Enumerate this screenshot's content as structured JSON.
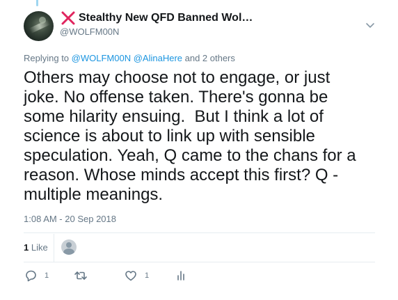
{
  "tweet": {
    "display_name": "Stealthy New QFD Banned Wol…",
    "handle": "@WOLFM00N",
    "reply_prefix": "Replying to ",
    "reply_handle_1": "@WOLFM00N",
    "reply_handle_2": "@AlinaHere",
    "reply_suffix": " and 2 others",
    "text": "Others may choose not to engage, or just\njoke. No offense taken. There's gonna be\nsome hilarity ensuing.  But I think a lot of\nscience is about to link up with sensible\nspeculation. Yeah, Q came to the chans for a\nreason. Whose minds accept this first? Q -\nmultiple meanings.",
    "timestamp": "1:08 AM - 20 Sep 2018"
  },
  "stats": {
    "like_count": "1",
    "like_label": "Like"
  },
  "actions": {
    "reply_count": "1",
    "retweet_count": "",
    "like_count": "1"
  },
  "icons": {
    "name_badge": "red-x-icon",
    "caret": "chevron-down-icon",
    "reply": "reply-icon",
    "retweet": "retweet-icon",
    "like": "heart-icon",
    "analytics": "analytics-icon"
  },
  "colors": {
    "link": "#1b95e0",
    "secondary_text": "#657786",
    "primary_text": "#14171a",
    "badge_red": "#e0245e"
  }
}
